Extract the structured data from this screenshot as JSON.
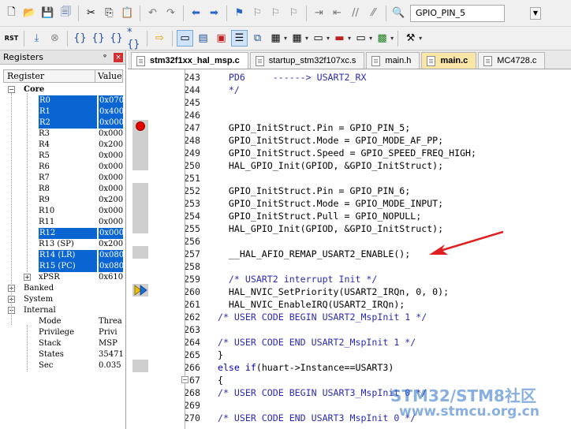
{
  "toolbar1": {
    "buttons": [
      "new-file-icon",
      "open-folder-icon",
      "save-icon",
      "save-all-icon",
      "cut-icon",
      "copy-icon",
      "paste-icon",
      "undo-icon",
      "redo-icon",
      "navigate-back-icon",
      "navigate-forward-icon",
      "bookmark-icon",
      "prev-bookmark-icon",
      "next-bookmark-icon",
      "clear-bookmarks-icon",
      "indent-icon",
      "unindent-icon",
      "comment-icon",
      "uncomment-icon",
      "find-in-files-icon"
    ],
    "target_select": "GPIO_PIN_5"
  },
  "toolbar2": {
    "reset_label": "RST",
    "buttons": [
      "reset-icon",
      "run-icon",
      "stop-icon",
      "step-into-icon",
      "step-over-icon",
      "step-out-icon",
      "run-to-cursor-icon",
      "show-next-statement-icon",
      "command-window-icon",
      "disassembly-window-icon",
      "symbols-window-icon",
      "registers-window-icon",
      "call-stack-window-icon",
      "watch-window-icon",
      "memory-window-icon",
      "serial-window-icon",
      "analysis-window-icon",
      "trace-window-icon",
      "system-viewer-icon",
      "toolbox-icon"
    ]
  },
  "registers_panel": {
    "title": "Registers",
    "pin_label": "ᵠ",
    "close_label": "×",
    "col_register": "Register",
    "col_value": "Value",
    "core_label": "Core",
    "core_regs": [
      {
        "name": "R0",
        "value": "0x070",
        "selected": true
      },
      {
        "name": "R1",
        "value": "0x400",
        "selected": true
      },
      {
        "name": "R2",
        "value": "0x000",
        "selected": true
      },
      {
        "name": "R3",
        "value": "0x000",
        "selected": false
      },
      {
        "name": "R4",
        "value": "0x200",
        "selected": false
      },
      {
        "name": "R5",
        "value": "0x000",
        "selected": false
      },
      {
        "name": "R6",
        "value": "0x000",
        "selected": false
      },
      {
        "name": "R7",
        "value": "0x000",
        "selected": false
      },
      {
        "name": "R8",
        "value": "0x000",
        "selected": false
      },
      {
        "name": "R9",
        "value": "0x200",
        "selected": false
      },
      {
        "name": "R10",
        "value": "0x000",
        "selected": false
      },
      {
        "name": "R11",
        "value": "0x000",
        "selected": false
      },
      {
        "name": "R12",
        "value": "0x000",
        "selected": true
      },
      {
        "name": "R13 (SP)",
        "value": "0x200",
        "selected": false
      },
      {
        "name": "R14 (LR)",
        "value": "0x080",
        "selected": true
      },
      {
        "name": "R15 (PC)",
        "value": "0x080",
        "selected": true
      },
      {
        "name": "xPSR",
        "value": "0x610",
        "selected": false
      }
    ],
    "banked_label": "Banked",
    "system_label": "System",
    "internal_label": "Internal",
    "internal_regs": [
      {
        "name": "Mode",
        "value": "Threa"
      },
      {
        "name": "Privilege",
        "value": "Privi"
      },
      {
        "name": "Stack",
        "value": "MSP"
      },
      {
        "name": "States",
        "value": "35471"
      },
      {
        "name": "Sec",
        "value": "0.035"
      }
    ]
  },
  "file_tabs": [
    {
      "label": "stm32f1xx_hal_msp.c",
      "state": "active"
    },
    {
      "label": "startup_stm32f107xc.s",
      "state": "normal"
    },
    {
      "label": "main.h",
      "state": "normal"
    },
    {
      "label": "main.c",
      "state": "highlight"
    },
    {
      "label": "MC4728.c",
      "state": "normal"
    }
  ],
  "code_lines": [
    {
      "n": "243",
      "text": "    PD6     ------> USART2_RX",
      "cls": "c-comment"
    },
    {
      "n": "244",
      "text": "    */",
      "cls": "c-comment"
    },
    {
      "n": "245",
      "text": "",
      "cls": "c-code"
    },
    {
      "n": "246",
      "text": "",
      "cls": "c-code"
    },
    {
      "n": "247",
      "text": "    GPIO_InitStruct.Pin = GPIO_PIN_5;",
      "cls": "c-code"
    },
    {
      "n": "248",
      "text": "    GPIO_InitStruct.Mode = GPIO_MODE_AF_PP;",
      "cls": "c-code"
    },
    {
      "n": "249",
      "text": "    GPIO_InitStruct.Speed = GPIO_SPEED_FREQ_HIGH;",
      "cls": "c-code"
    },
    {
      "n": "250",
      "text": "    HAL_GPIO_Init(GPIOD, &GPIO_InitStruct);",
      "cls": "c-code"
    },
    {
      "n": "251",
      "text": "",
      "cls": "c-code"
    },
    {
      "n": "252",
      "text": "    GPIO_InitStruct.Pin = GPIO_PIN_6;",
      "cls": "c-code"
    },
    {
      "n": "253",
      "text": "    GPIO_InitStruct.Mode = GPIO_MODE_INPUT;",
      "cls": "c-code"
    },
    {
      "n": "254",
      "text": "    GPIO_InitStruct.Pull = GPIO_NOPULL;",
      "cls": "c-code"
    },
    {
      "n": "255",
      "text": "    HAL_GPIO_Init(GPIOD, &GPIO_InitStruct);",
      "cls": "c-code"
    },
    {
      "n": "256",
      "text": "",
      "cls": "c-code"
    },
    {
      "n": "257",
      "text": "    __HAL_AFIO_REMAP_USART2_ENABLE();",
      "cls": "c-code"
    },
    {
      "n": "258",
      "text": "",
      "cls": "c-code"
    },
    {
      "n": "259",
      "text": "    /* USART2 interrupt Init */",
      "cls": "c-comment"
    },
    {
      "n": "260",
      "text": "    HAL_NVIC_SetPriority(USART2_IRQn, 0, 0);",
      "cls": "c-code"
    },
    {
      "n": "261",
      "text": "    HAL_NVIC_EnableIRQ(USART2_IRQn);",
      "cls": "c-code"
    },
    {
      "n": "262",
      "text": "  /* USER CODE BEGIN USART2_MspInit 1 */",
      "cls": "c-comment"
    },
    {
      "n": "263",
      "text": "",
      "cls": "c-code"
    },
    {
      "n": "264",
      "text": "  /* USER CODE END USART2_MspInit 1 */",
      "cls": "c-comment"
    },
    {
      "n": "265",
      "text": "  }",
      "cls": "c-code"
    },
    {
      "n": "266",
      "text": "  else if(huart->Instance==USART3)",
      "cls": "c-code"
    },
    {
      "n": "267",
      "text": "  {",
      "cls": "c-code"
    },
    {
      "n": "268",
      "text": "  /* USER CODE BEGIN USART3_MspInit 0 */",
      "cls": "c-comment"
    },
    {
      "n": "269",
      "text": "",
      "cls": "c-code"
    },
    {
      "n": "270",
      "text": "  /* USER CODE END USART3 MspInit 0 */",
      "cls": "c-comment"
    }
  ],
  "watermark": {
    "line1": "STM32/STM8社区",
    "line2": "www.stmcu.org.cn"
  },
  "colors": {
    "selection": "#0a64d2",
    "breakpoint": "#e00000",
    "arrow": "#e02020",
    "comment": "#2b2bb3"
  }
}
